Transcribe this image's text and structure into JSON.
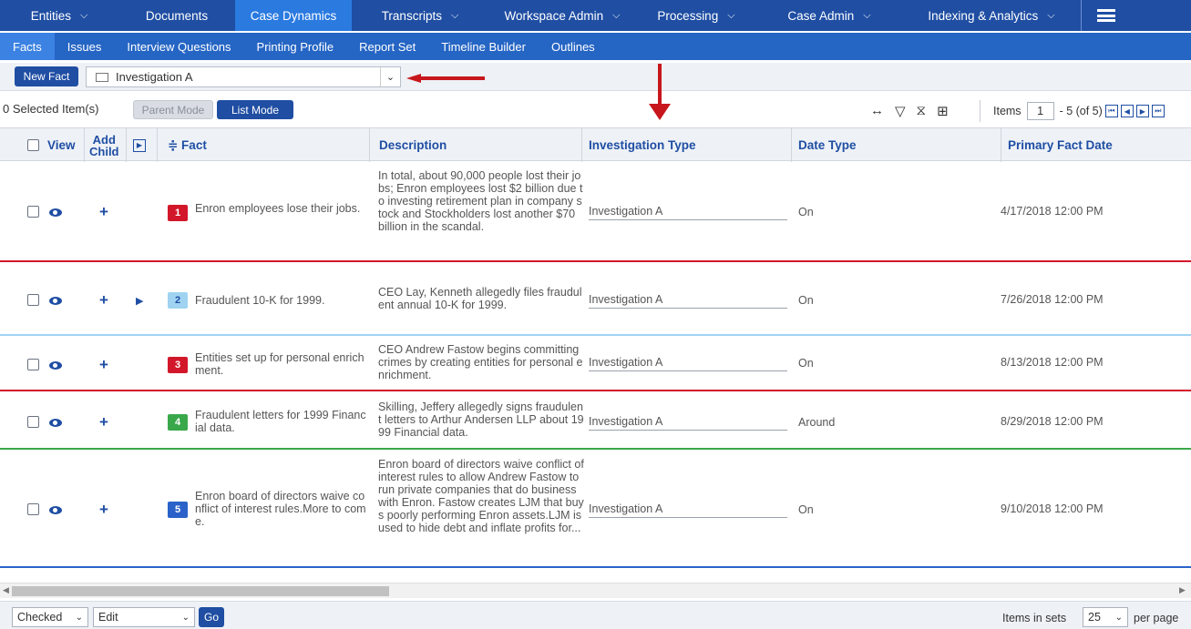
{
  "topnav": {
    "tabs": [
      {
        "label": "Entities",
        "has_menu": true
      },
      {
        "label": "Documents",
        "has_menu": false
      },
      {
        "label": "Case Dynamics",
        "has_menu": false,
        "active": true
      },
      {
        "label": "Transcripts",
        "has_menu": true
      },
      {
        "label": "Workspace Admin",
        "has_menu": true
      },
      {
        "label": "Processing",
        "has_menu": true
      },
      {
        "label": "Case Admin",
        "has_menu": true
      },
      {
        "label": "Indexing & Analytics",
        "has_menu": true
      }
    ],
    "chevron": "⌄"
  },
  "subnav": {
    "items": [
      "Facts",
      "Issues",
      "Interview Questions",
      "Printing Profile",
      "Report Set",
      "Timeline Builder",
      "Outlines"
    ],
    "active": "Facts"
  },
  "toolbar": {
    "new_fact_label": "New Fact",
    "investigation_select_value": "Investigation A",
    "selected_count_text": "0 Selected Item(s)",
    "parent_mode_label": "Parent Mode",
    "list_mode_label": "List Mode"
  },
  "pager": {
    "items_label": "Items",
    "page_value": "1",
    "range_text": "- 5 (of 5)"
  },
  "table": {
    "headers": {
      "view": "View",
      "add_child_line1": "Add",
      "add_child_line2": "Child",
      "fact": "≑ Fact",
      "description": "Description",
      "investigation_type": "Investigation Type",
      "date_type": "Date Type",
      "primary_fact_date": "Primary Fact Date"
    },
    "rows": [
      {
        "num": "1",
        "badge_color": "#d3172b",
        "fact": "Enron employees lose their jobs.",
        "description": "In total, about 90,000 people lost their jobs; Enron employees lost $2 billion due to investing retirement plan in company stock and Stockholders lost another $70 billion in the scandal.",
        "investigation_type": "Investigation A",
        "date_type": "On",
        "primary_fact_date": "4/17/2018 12:00 PM",
        "has_children": false,
        "border_color": "#d3172b"
      },
      {
        "num": "2",
        "badge_color": "#9fd3f1",
        "badge_text_color": "#1f4ea3",
        "fact": "Fraudulent 10-K for 1999.",
        "description": "CEO Lay, Kenneth allegedly files fraudulent annual 10-K for 1999.",
        "investigation_type": "Investigation A",
        "date_type": "On",
        "primary_fact_date": "7/26/2018 12:00 PM",
        "has_children": true,
        "border_color": "#9fd3f1"
      },
      {
        "num": "3",
        "badge_color": "#d3172b",
        "fact": "Entities set up for personal enrichment.",
        "description": "CEO Andrew Fastow begins committing crimes by creating entities for personal enrichment.",
        "investigation_type": "Investigation A",
        "date_type": "On",
        "primary_fact_date": "8/13/2018 12:00 PM",
        "has_children": false,
        "border_color": "#d3172b"
      },
      {
        "num": "4",
        "badge_color": "#3aa84a",
        "fact": "Fraudulent letters for 1999 Financial data.",
        "description": "Skilling, Jeffery allegedly signs fraudulent letters to Arthur Andersen LLP about 1999 Financial data.",
        "investigation_type": "Investigation A",
        "date_type": "Around",
        "primary_fact_date": "8/29/2018 12:00 PM",
        "has_children": false,
        "border_color": "#3aa84a"
      },
      {
        "num": "5",
        "badge_color": "#2a62c9",
        "fact": "Enron board of directors waive conflict of interest rules.More to come.",
        "description": "Enron board of directors waive conflict of interest rules to allow Andrew Fastow to run private companies that do business with Enron. Fastow creates LJM that buys poorly performing Enron assets.LJM is used to hide debt and inflate profits for...",
        "investigation_type": "Investigation A",
        "date_type": "On",
        "primary_fact_date": "9/10/2018 12:00 PM",
        "has_children": false,
        "border_color": "#2a62c9"
      }
    ]
  },
  "footer": {
    "checked_select": "Checked",
    "action_select": "Edit",
    "go_label": "Go",
    "items_in_sets_label": "Items in sets",
    "per_page_value": "25",
    "per_page_label": "per page"
  }
}
